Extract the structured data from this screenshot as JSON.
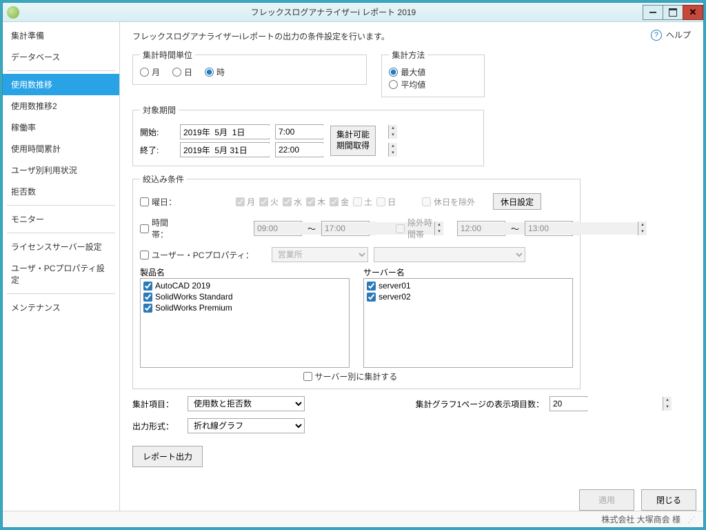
{
  "title": "フレックスログアナライザーi レポート 2019",
  "help_label": "ヘルプ",
  "description": "フレックスログアナライザーiレポートの出力の条件設定を行います。",
  "sidebar": {
    "items": [
      "集計準備",
      "データベース",
      "使用数推移",
      "使用数推移2",
      "稼働率",
      "使用時間累計",
      "ユーザ別利用状況",
      "拒否数",
      "モニター",
      "ライセンスサーバー設定",
      "ユーザ・PCプロパティ設定",
      "メンテナンス"
    ],
    "selected_index": 2,
    "separators_after": [
      1,
      7,
      8,
      10
    ]
  },
  "group_unit": {
    "legend": "集計時間単位",
    "options": [
      "月",
      "日",
      "時"
    ],
    "selected": 2
  },
  "group_method": {
    "legend": "集計方法",
    "options": [
      "最大値",
      "平均値"
    ],
    "selected": 0
  },
  "period": {
    "legend": "対象期間",
    "start_label": "開始:",
    "end_label": "終了:",
    "start_date": "2019年  5月  1日",
    "end_date": "2019年  5月 31日",
    "start_time": "7:00",
    "end_time": "22:00",
    "fetch_button": "集計可能\n期間取得"
  },
  "filter": {
    "legend": "絞込み条件",
    "weekday_label": "曜日：",
    "days": [
      "月",
      "火",
      "水",
      "木",
      "金",
      "土",
      "日"
    ],
    "days_checked": [
      true,
      true,
      true,
      true,
      true,
      false,
      false
    ],
    "exclude_holiday": "休日を除外",
    "holiday_button": "休日設定",
    "timerange_label": "時間帯：",
    "time_from": "09:00",
    "time_to": "17:00",
    "exclude_label": "除外時間帯",
    "ex_from": "12:00",
    "ex_to": "13:00",
    "tilde": "～",
    "userpc_label": "ユーザー・PCプロパティ：",
    "userpc_select": "営業所",
    "products_label": "製品名",
    "products": [
      "AutoCAD 2019",
      "SolidWorks Standard",
      "SolidWorks Premium"
    ],
    "servers_label": "サーバー名",
    "servers": [
      "server01",
      "server02"
    ],
    "per_server": "サーバー別に集計する"
  },
  "output": {
    "item_label": "集計項目：",
    "item_value": "使用数と拒否数",
    "format_label": "出力形式：",
    "format_value": "折れ線グラフ",
    "page_items_label": "集計グラフ1ページの表示項目数：",
    "page_items_value": "20",
    "run_button": "レポート出力"
  },
  "footer": {
    "apply": "適用",
    "close": "閉じる",
    "company": "株式会社 大塚商会 様"
  }
}
